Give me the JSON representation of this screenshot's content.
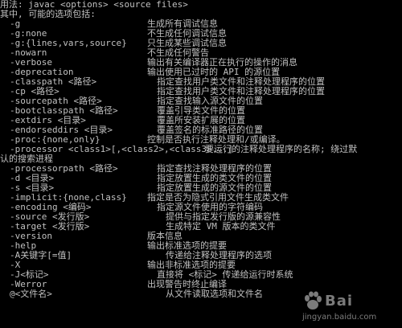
{
  "console": {
    "usage": "用法: javac <options> <source files>",
    "intro": "其中, 可能的选项包括:",
    "rows": [
      {
        "opt": "-g",
        "desc": "生成所有调试信息"
      },
      {
        "opt": "-g:none",
        "desc": "不生成任何调试信息"
      },
      {
        "opt": "-g:{lines,vars,source}",
        "desc": "只生成某些调试信息"
      },
      {
        "opt": "-nowarn",
        "desc": "不生成任何警告"
      },
      {
        "opt": "-verbose",
        "desc": "输出有关编译器正在执行的操作的消息"
      },
      {
        "opt": "-deprecation",
        "desc": "输出使用已过时的 API 的源位置"
      },
      {
        "opt": "-classpath <路径>",
        "desc": "指定查找用户类文件和注释处理程序的位置"
      },
      {
        "opt": "-cp <路径>",
        "desc": "指定查找用户类文件和注释处理程序的位置"
      },
      {
        "opt": "-sourcepath <路径>",
        "desc": "指定查找输入源文件的位置"
      },
      {
        "opt": "-bootclasspath <路径>",
        "desc": "覆盖引导类文件的位置"
      },
      {
        "opt": "-extdirs <目录>",
        "desc": "覆盖所安装扩展的位置"
      },
      {
        "opt": "-endorseddirs <目录>",
        "desc": "覆盖签名的标准路径的位置"
      },
      {
        "opt": "-proc:{none,only}",
        "desc": "控制是否执行注释处理和/或编译。"
      }
    ],
    "processor_opt": "-processor <class1>[,<class2>,<class3>...]",
    "processor_desc_1": "要运行的注释处理程序的名称; 绕过默",
    "processor_desc_2": "认的搜索进程",
    "rows2": [
      {
        "opt": "-processorpath <路径>",
        "desc": "指定查找注释处理程序的位置"
      },
      {
        "opt": "-d <目录>",
        "desc": "指定放置生成的类文件的位置"
      },
      {
        "opt": "-s <目录>",
        "desc": "指定放置生成的源文件的位置"
      },
      {
        "opt": "-implicit:{none,class}",
        "desc": "指定是否为隐式引用文件生成类文件"
      },
      {
        "opt": "-encoding <编码>",
        "desc": "指定源文件使用的字符编码"
      },
      {
        "opt": "-source <发行版>",
        "desc": "提供与指定发行版的源兼容性"
      },
      {
        "opt": "-target <发行版>",
        "desc": "生成特定 VM 版本的类文件"
      },
      {
        "opt": "-version",
        "desc": "版本信息"
      },
      {
        "opt": "-help",
        "desc": "输出标准选项的提要"
      },
      {
        "opt": "-A关键字[=值]",
        "desc": "传递给注释处理程序的选项"
      },
      {
        "opt": "-X",
        "desc": "输出非标准选项的提要"
      },
      {
        "opt": "-J<标记>",
        "desc": "直接将 <标记> 传递给运行时系统"
      },
      {
        "opt": "-Werror",
        "desc": "出现警告时终止编译"
      },
      {
        "opt": "@<文件名>",
        "desc": "从文件读取选项和文件名"
      }
    ]
  },
  "watermark": {
    "brand": "Bai",
    "url": "jingyan.baidu.com"
  }
}
